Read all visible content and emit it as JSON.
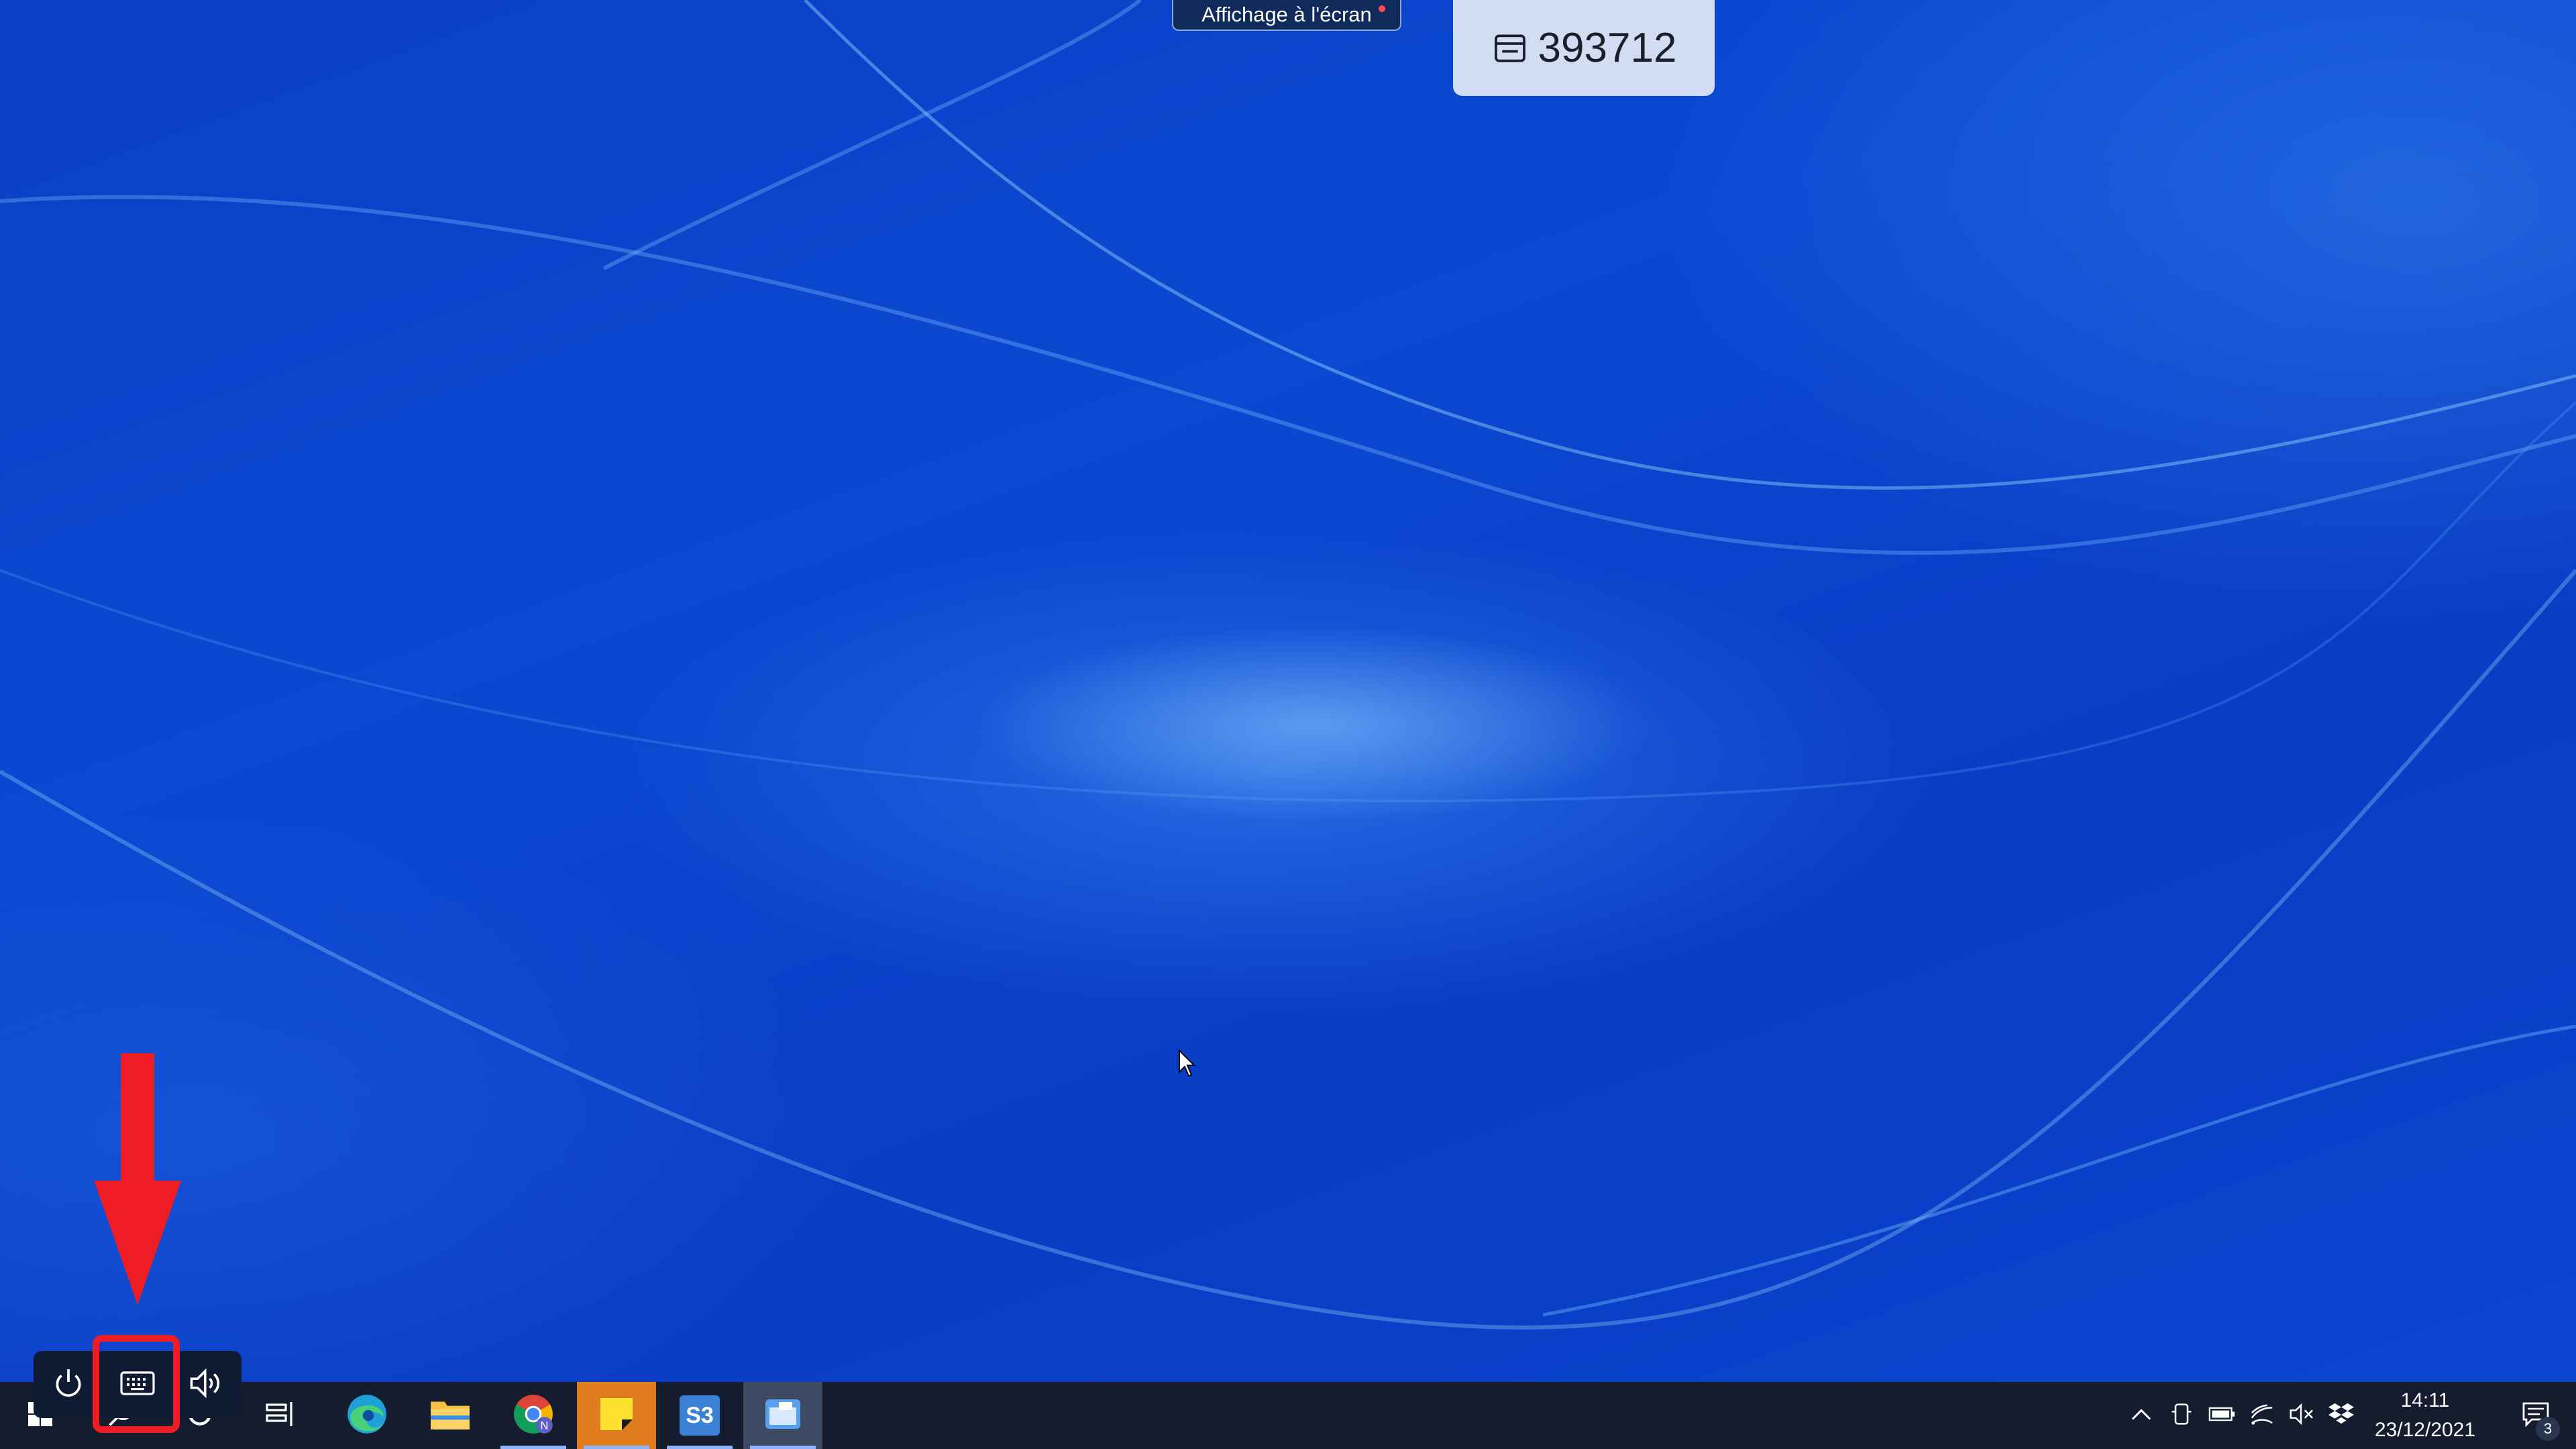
{
  "overlay": {
    "screen_share_label": "Affichage à l'écran",
    "session_code": "393712"
  },
  "quick_controls": {
    "items": [
      {
        "icon": "power-icon"
      },
      {
        "icon": "keyboard-icon"
      },
      {
        "icon": "volume-icon"
      }
    ]
  },
  "taskbar": {
    "start_icon": "windows-start-icon",
    "search_icon": "search-icon",
    "cortana_icon": "cortana-icon",
    "task_view_icon": "task-view-icon",
    "apps": [
      {
        "name": "edge",
        "icon": "edge-icon",
        "running": false
      },
      {
        "name": "file-explorer",
        "icon": "folder-icon",
        "running": false
      },
      {
        "name": "chrome",
        "icon": "chrome-icon",
        "running": true
      },
      {
        "name": "sticky-notes",
        "icon": "sticky-notes-icon",
        "running": true
      },
      {
        "name": "s3",
        "icon": "s3-app-icon",
        "running": true
      },
      {
        "name": "remote-app",
        "icon": "window-app-icon",
        "running": true
      }
    ],
    "s3_label": "S3",
    "tray": {
      "icons": [
        "chevron-up-icon",
        "phone-icon",
        "battery-icon",
        "wifi-icon",
        "speaker-muted-icon",
        "dropbox-icon"
      ],
      "time": "14:11",
      "date": "23/12/2021",
      "notification_count": "3"
    }
  },
  "annotation": {
    "arrow_color": "#ee1c24",
    "highlight_color": "#ee1c24"
  }
}
